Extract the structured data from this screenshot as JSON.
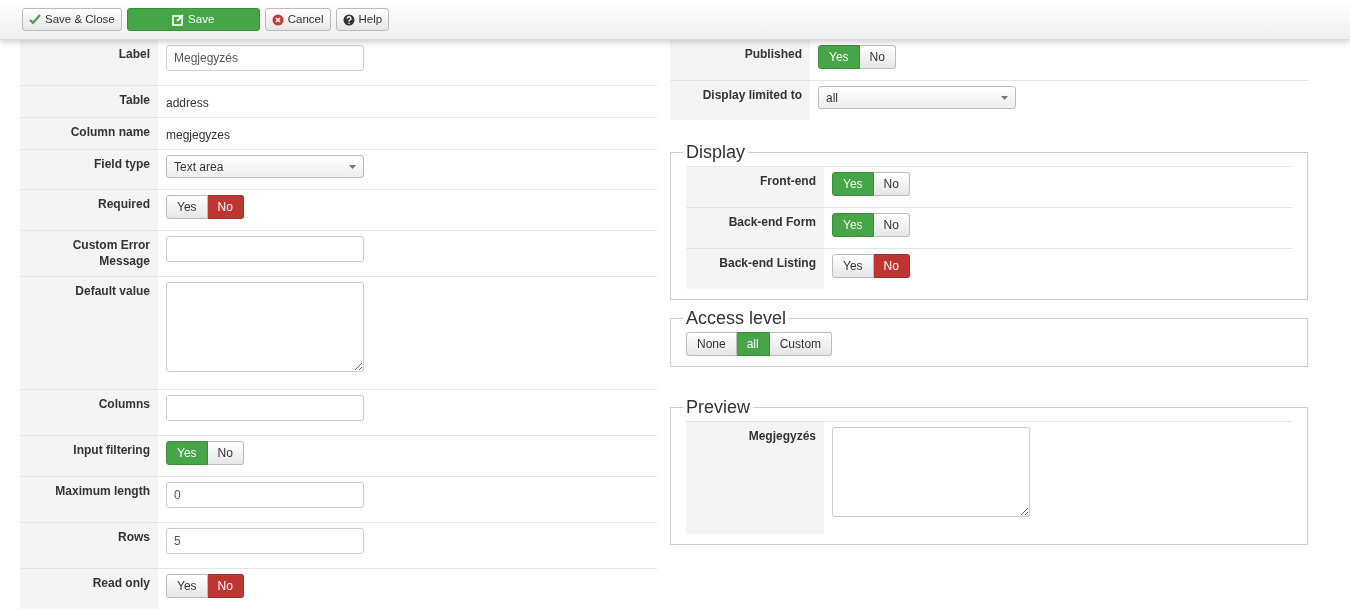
{
  "toolbar": [
    {
      "label": "Save & Close",
      "kind": "default"
    },
    {
      "label": "Save",
      "kind": "primary"
    },
    {
      "label": "Cancel",
      "kind": "default"
    },
    {
      "label": "Help",
      "kind": "default"
    }
  ],
  "left_fields": [
    {
      "label": "Label",
      "kind": "input",
      "value": "Megjegyzés"
    },
    {
      "label": "Table",
      "kind": "text",
      "value": "address"
    },
    {
      "label": "Column name",
      "kind": "text",
      "value": "megjegyzes"
    },
    {
      "label": "Field type",
      "kind": "select",
      "value": "Text area"
    },
    {
      "label": "Required",
      "kind": "toggle",
      "options": [
        {
          "label": "Yes",
          "selected": false
        },
        {
          "label": "No",
          "selected": true
        }
      ]
    },
    {
      "label": "Custom Error Message",
      "kind": "input"
    },
    {
      "label": "Default value",
      "kind": "textarea"
    },
    {
      "label": "Columns",
      "kind": "input"
    },
    {
      "label": "Input filtering",
      "kind": "toggle",
      "options": [
        {
          "label": "Yes",
          "selected": true
        },
        {
          "label": "No",
          "selected": false
        }
      ]
    },
    {
      "label": "Maximum length",
      "kind": "input",
      "value": "0"
    },
    {
      "label": "Rows",
      "kind": "input",
      "value": "5"
    },
    {
      "label": "Read only",
      "kind": "toggle",
      "options": [
        {
          "label": "Yes",
          "selected": false
        },
        {
          "label": "No",
          "selected": true
        }
      ]
    }
  ],
  "right_fields": [
    {
      "label": "Published",
      "kind": "toggle",
      "options": [
        {
          "label": "Yes",
          "selected": true
        },
        {
          "label": "No",
          "selected": false
        }
      ]
    },
    {
      "label": "Display limited to",
      "kind": "select",
      "value": "all"
    }
  ],
  "sections": [
    {
      "legend": "Display",
      "fields": [
        {
          "label": "Front-end",
          "kind": "toggle",
          "options": [
            {
              "label": "Yes",
              "selected": true
            },
            {
              "label": "No",
              "selected": false
            }
          ]
        },
        {
          "label": "Back-end Form",
          "kind": "toggle",
          "options": [
            {
              "label": "Yes",
              "selected": true
            },
            {
              "label": "No",
              "selected": false
            }
          ]
        },
        {
          "label": "Back-end Listing",
          "kind": "toggle",
          "options": [
            {
              "label": "Yes",
              "selected": false
            },
            {
              "label": "No",
              "selected": true
            }
          ]
        }
      ]
    },
    {
      "legend": "Access level",
      "toggle": [
        {
          "label": "None",
          "selected": false
        },
        {
          "label": "all",
          "selected": true
        },
        {
          "label": "Custom",
          "selected": false
        }
      ]
    },
    {
      "legend": "Preview",
      "fields": [
        {
          "label": "Megjegyzés",
          "kind": "textarea"
        }
      ]
    }
  ]
}
